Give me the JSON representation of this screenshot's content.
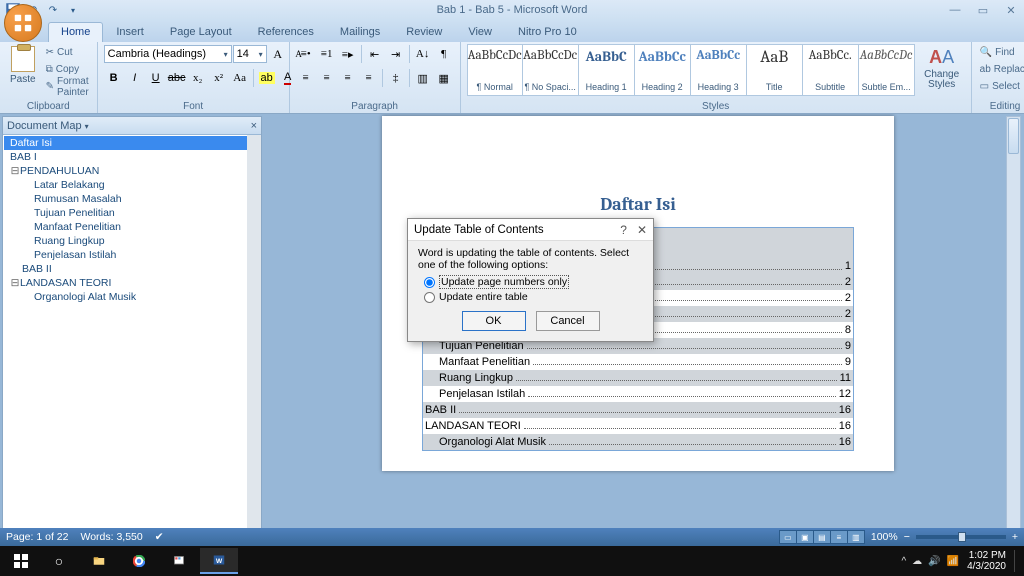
{
  "title": "Bab 1 - Bab 5 - Microsoft Word",
  "tabs": [
    "Home",
    "Insert",
    "Page Layout",
    "References",
    "Mailings",
    "Review",
    "View",
    "Nitro Pro 10"
  ],
  "active_tab": 0,
  "ribbon": {
    "clipboard": {
      "label": "Clipboard",
      "paste": "Paste",
      "cut": "Cut",
      "copy": "Copy",
      "format_painter": "Format Painter"
    },
    "font": {
      "label": "Font",
      "family": "Cambria (Headings)",
      "size": "14"
    },
    "paragraph": {
      "label": "Paragraph"
    },
    "styles": {
      "label": "Styles",
      "items": [
        {
          "preview": "AaBbCcDc",
          "name": "¶ Normal",
          "cls": ""
        },
        {
          "preview": "AaBbCcDc",
          "name": "¶ No Spaci...",
          "cls": ""
        },
        {
          "preview": "AaBbC",
          "name": "Heading 1",
          "cls": "h1"
        },
        {
          "preview": "AaBbCc",
          "name": "Heading 2",
          "cls": "h2"
        },
        {
          "preview": "AaBbCc",
          "name": "Heading 3",
          "cls": "h3"
        },
        {
          "preview": "AaB",
          "name": "Title",
          "cls": "title"
        },
        {
          "preview": "AaBbCc.",
          "name": "Subtitle",
          "cls": ""
        },
        {
          "preview": "AaBbCcDc",
          "name": "Subtle Em...",
          "cls": "em"
        }
      ],
      "change": "Change Styles"
    },
    "editing": {
      "label": "Editing",
      "find": "Find",
      "replace": "Replace",
      "select": "Select"
    }
  },
  "docmap": {
    "title": "Document Map",
    "items": [
      {
        "text": "Daftar Isi",
        "indent": 0,
        "selected": true
      },
      {
        "text": "BAB I",
        "indent": 0
      },
      {
        "text": "PENDAHULUAN",
        "indent": 0,
        "expandable": true
      },
      {
        "text": "Latar Belakang",
        "indent": 2
      },
      {
        "text": "Rumusan Masalah",
        "indent": 2
      },
      {
        "text": "Tujuan Penelitian",
        "indent": 2
      },
      {
        "text": "Manfaat Penelitian",
        "indent": 2
      },
      {
        "text": "Ruang Lingkup",
        "indent": 2
      },
      {
        "text": "Penjelasan Istilah",
        "indent": 2
      },
      {
        "text": "BAB II",
        "indent": 1
      },
      {
        "text": "LANDASAN TEORI",
        "indent": 0,
        "expandable": true
      },
      {
        "text": "Organologi Alat Musik",
        "indent": 2
      }
    ]
  },
  "document": {
    "heading": "Daftar Isi",
    "toc": [
      {
        "text": "",
        "page": "1",
        "indent": 0,
        "shaded": true,
        "spacer": true
      },
      {
        "text": "BAB I",
        "page": "2",
        "indent": 0,
        "shaded": true
      },
      {
        "text": "PENDAHULUAN",
        "page": "2",
        "indent": 0
      },
      {
        "text": "Latar Belakang",
        "page": "2",
        "indent": 1,
        "shaded": true
      },
      {
        "text": "Rumusan Masalah",
        "page": "8",
        "indent": 1
      },
      {
        "text": "Tujuan Penelitian",
        "page": "9",
        "indent": 1,
        "shaded": true
      },
      {
        "text": "Manfaat Penelitian",
        "page": "9",
        "indent": 1
      },
      {
        "text": "Ruang Lingkup",
        "page": "11",
        "indent": 1,
        "shaded": true
      },
      {
        "text": "Penjelasan Istilah",
        "page": "12",
        "indent": 1
      },
      {
        "text": "BAB II",
        "page": "16",
        "indent": 0,
        "shaded": true
      },
      {
        "text": "LANDASAN TEORI",
        "page": "16",
        "indent": 0
      },
      {
        "text": "Organologi Alat Musik",
        "page": "16",
        "indent": 1,
        "shaded": true
      }
    ]
  },
  "dialog": {
    "title": "Update Table of Contents",
    "message": "Word is updating the table of contents. Select one of the following options:",
    "opt_pages": "Update page numbers only",
    "opt_entire": "Update entire table",
    "ok": "OK",
    "cancel": "Cancel"
  },
  "status": {
    "page": "Page: 1 of 22",
    "words": "Words: 3,550",
    "zoom": "100%"
  },
  "taskbar": {
    "time": "1:02 PM",
    "date": "4/3/2020"
  }
}
